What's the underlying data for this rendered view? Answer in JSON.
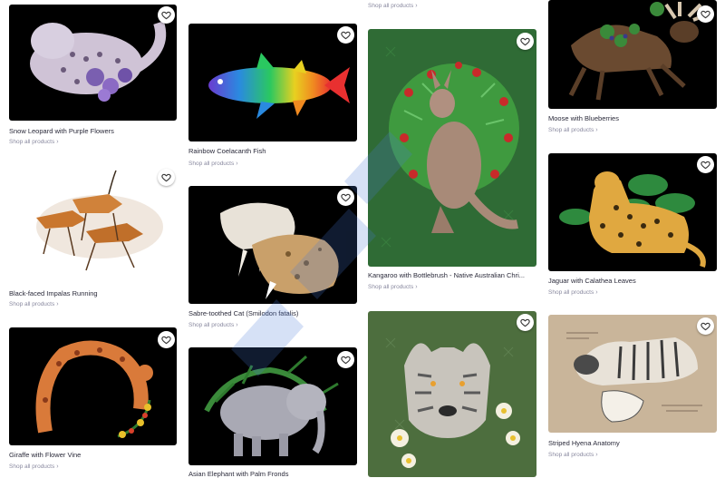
{
  "colors": {
    "black_bg": "#000000",
    "green_bg": "#2f6b35",
    "sage_bg": "#4d6e3e",
    "kraft_bg": "#c9b59a",
    "white_bg": "#ffffff"
  },
  "cards": [
    {
      "title": "Snow Leopard with Purple Flowers",
      "shop": "Shop all products"
    },
    {
      "title": "Black-faced Impalas Running",
      "shop": "Shop all products"
    },
    {
      "title": "Giraffe with Flower Vine",
      "shop": "Shop all products"
    },
    {
      "title": "Rainbow Coelacanth Fish",
      "shop": "Shop all products"
    },
    {
      "title": "Sabre-toothed Cat (Smilodon fatalis)",
      "shop": "Shop all products"
    },
    {
      "title": "Asian Elephant with Palm Fronds",
      "shop": ""
    },
    {
      "title": "",
      "shop": "Shop all products"
    },
    {
      "title": "Kangaroo with Bottlebrush - Native Australian Chri...",
      "shop": "Shop all products"
    },
    {
      "title": "",
      "shop": ""
    },
    {
      "title": "Moose with Blueberries",
      "shop": "Shop all products"
    },
    {
      "title": "Jaguar with Calathea Leaves",
      "shop": "Shop all products"
    },
    {
      "title": "Striped Hyena Anatomy",
      "shop": "Shop all products"
    }
  ]
}
